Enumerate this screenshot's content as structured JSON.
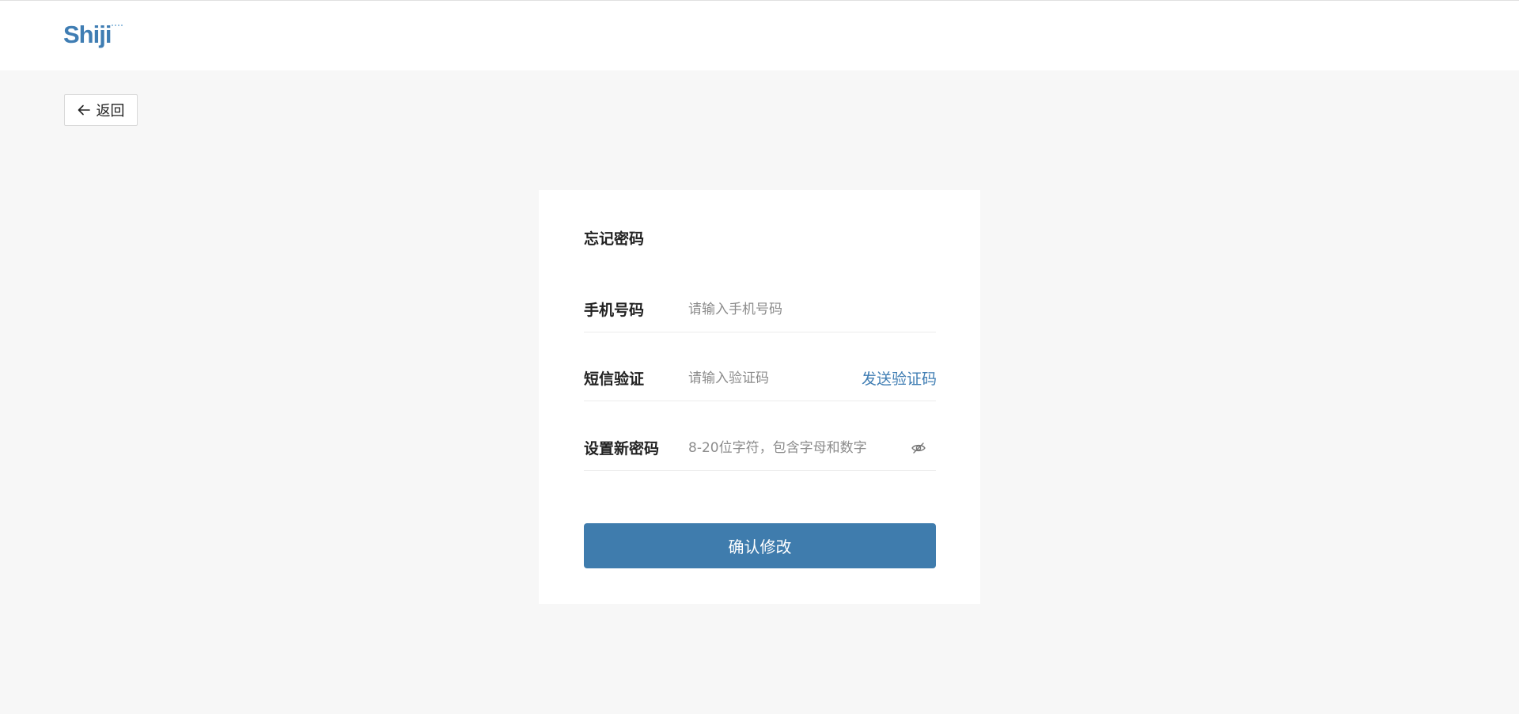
{
  "header": {
    "logo_text": "Shiji",
    "colors": {
      "logo": "#3f7db3",
      "logo_dots": "#7aaed6"
    }
  },
  "back_button": {
    "label": "返回",
    "icon": "arrow-left-icon"
  },
  "form": {
    "title": "忘记密码",
    "phone": {
      "label": "手机号码",
      "value": "",
      "placeholder": "请输入手机号码"
    },
    "sms": {
      "label": "短信验证",
      "value": "",
      "placeholder": "请输入验证码",
      "send_code_label": "发送验证码"
    },
    "password": {
      "label": "设置新密码",
      "value": "",
      "placeholder": "8-20位字符，包含字母和数字",
      "toggle_icon": "eye-off-icon"
    },
    "submit_label": "确认修改"
  },
  "colors": {
    "accent": "#3f7cad",
    "link": "#3f7db3",
    "background": "#f7f7f7"
  }
}
